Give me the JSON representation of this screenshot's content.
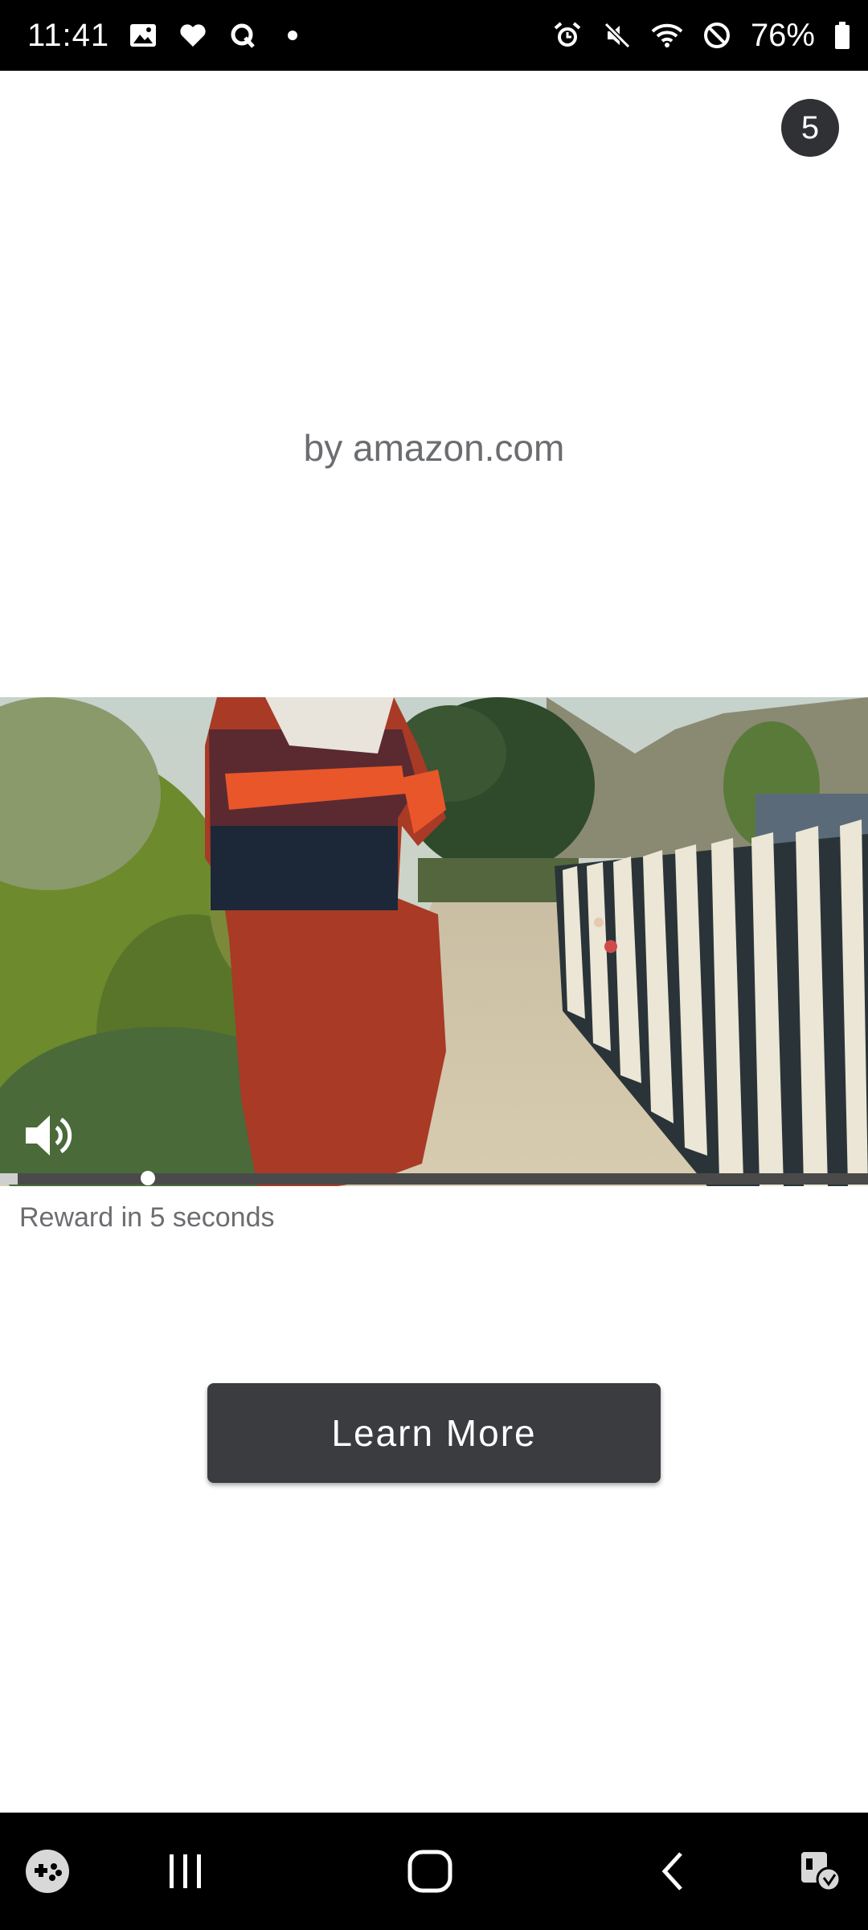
{
  "status_bar": {
    "time": "11:41",
    "left_icons": [
      "gallery-icon",
      "heart-icon",
      "q-app-icon",
      "dot-icon"
    ],
    "right_icons": [
      "alarm-icon",
      "mute-icon",
      "wifi-icon",
      "do-not-disturb-icon",
      "battery-icon"
    ],
    "battery": "76%"
  },
  "ad": {
    "countdown": "5",
    "advertiser": "by amazon.com",
    "reward_text": "Reward in 5 seconds",
    "cta_label": "Learn More",
    "video_progress": 0.17
  },
  "nav_bar": {
    "items": [
      "game-launcher-icon",
      "recent-apps-icon",
      "home-icon",
      "back-icon",
      "accessibility-icon"
    ]
  }
}
